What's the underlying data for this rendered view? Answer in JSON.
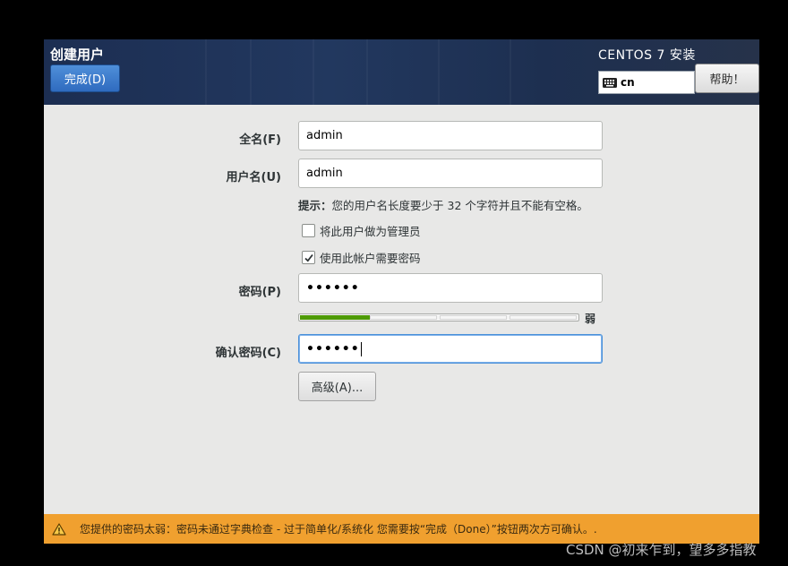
{
  "header": {
    "page_title": "创建用户",
    "done_label": "完成(D)",
    "product_title": "CENTOS 7 安装",
    "keyboard_layout": "cn",
    "help_label": "帮助！"
  },
  "form": {
    "fullname_label": "全名(F)",
    "fullname_value": "admin",
    "username_label": "用户名(U)",
    "username_value": "admin",
    "hint_prefix": "提示：",
    "hint_text": "您的用户名长度要少于 32 个字符并且不能有空格。",
    "admin_checkbox_label": "将此用户做为管理员",
    "admin_checked": false,
    "require_password_label": "使用此帐户需要密码",
    "require_password_checked": true,
    "password_label": "密码(P)",
    "password_value": "••••••",
    "strength_fraction": 0.25,
    "strength_label": "弱",
    "confirm_label": "确认密码(C)",
    "confirm_value": "••••••",
    "advanced_label": "高级(A)..."
  },
  "warning": {
    "text": "您提供的密码太弱：密码未通过字典检查 - 过于简单化/系统化 您需要按“完成（Done）”按钮两次方可确认。."
  },
  "watermark": "CSDN @初来乍到，望多多指教",
  "colors": {
    "accent": "#2f6bbf",
    "strength_weak": "#4e9a06",
    "warning_bg": "#f0a02f"
  }
}
